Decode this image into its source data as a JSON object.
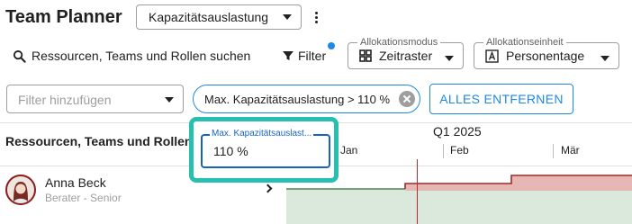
{
  "header": {
    "title": "Team Planner",
    "view_select": "Kapazitätsauslastung",
    "more_icon": "more-vert-icon"
  },
  "toolbar": {
    "search_label": "Ressourcen, Teams und Rollen suchen",
    "filter_label": "Filter",
    "allocation_mode": {
      "label": "Allokationsmodus",
      "value": "Zeitraster"
    },
    "allocation_unit": {
      "label": "Allokationseinheit",
      "value": "Personentage"
    }
  },
  "filters": {
    "add_placeholder": "Filter hinzufügen",
    "active_chip": "Max. Kapazitätsauslastung > 110 %",
    "clear_all_label": "ALLES ENTFERNEN"
  },
  "popover": {
    "field_label": "Max. Kapazitätsauslast...",
    "field_value": "110 %"
  },
  "timeline": {
    "column_header": "Ressourcen, Teams und Rollen",
    "quarter": "Q1 2025",
    "months": [
      "Jan",
      "Feb",
      "Mär"
    ]
  },
  "rows": [
    {
      "name": "Anna Beck",
      "role": "Berater - Senior"
    }
  ],
  "colors": {
    "accent": "#1e88e5",
    "focus_highlight": "#26bfb0",
    "over_capacity": "#e6b7b4",
    "capacity": "#dbe8dc",
    "today": "#c62828"
  }
}
